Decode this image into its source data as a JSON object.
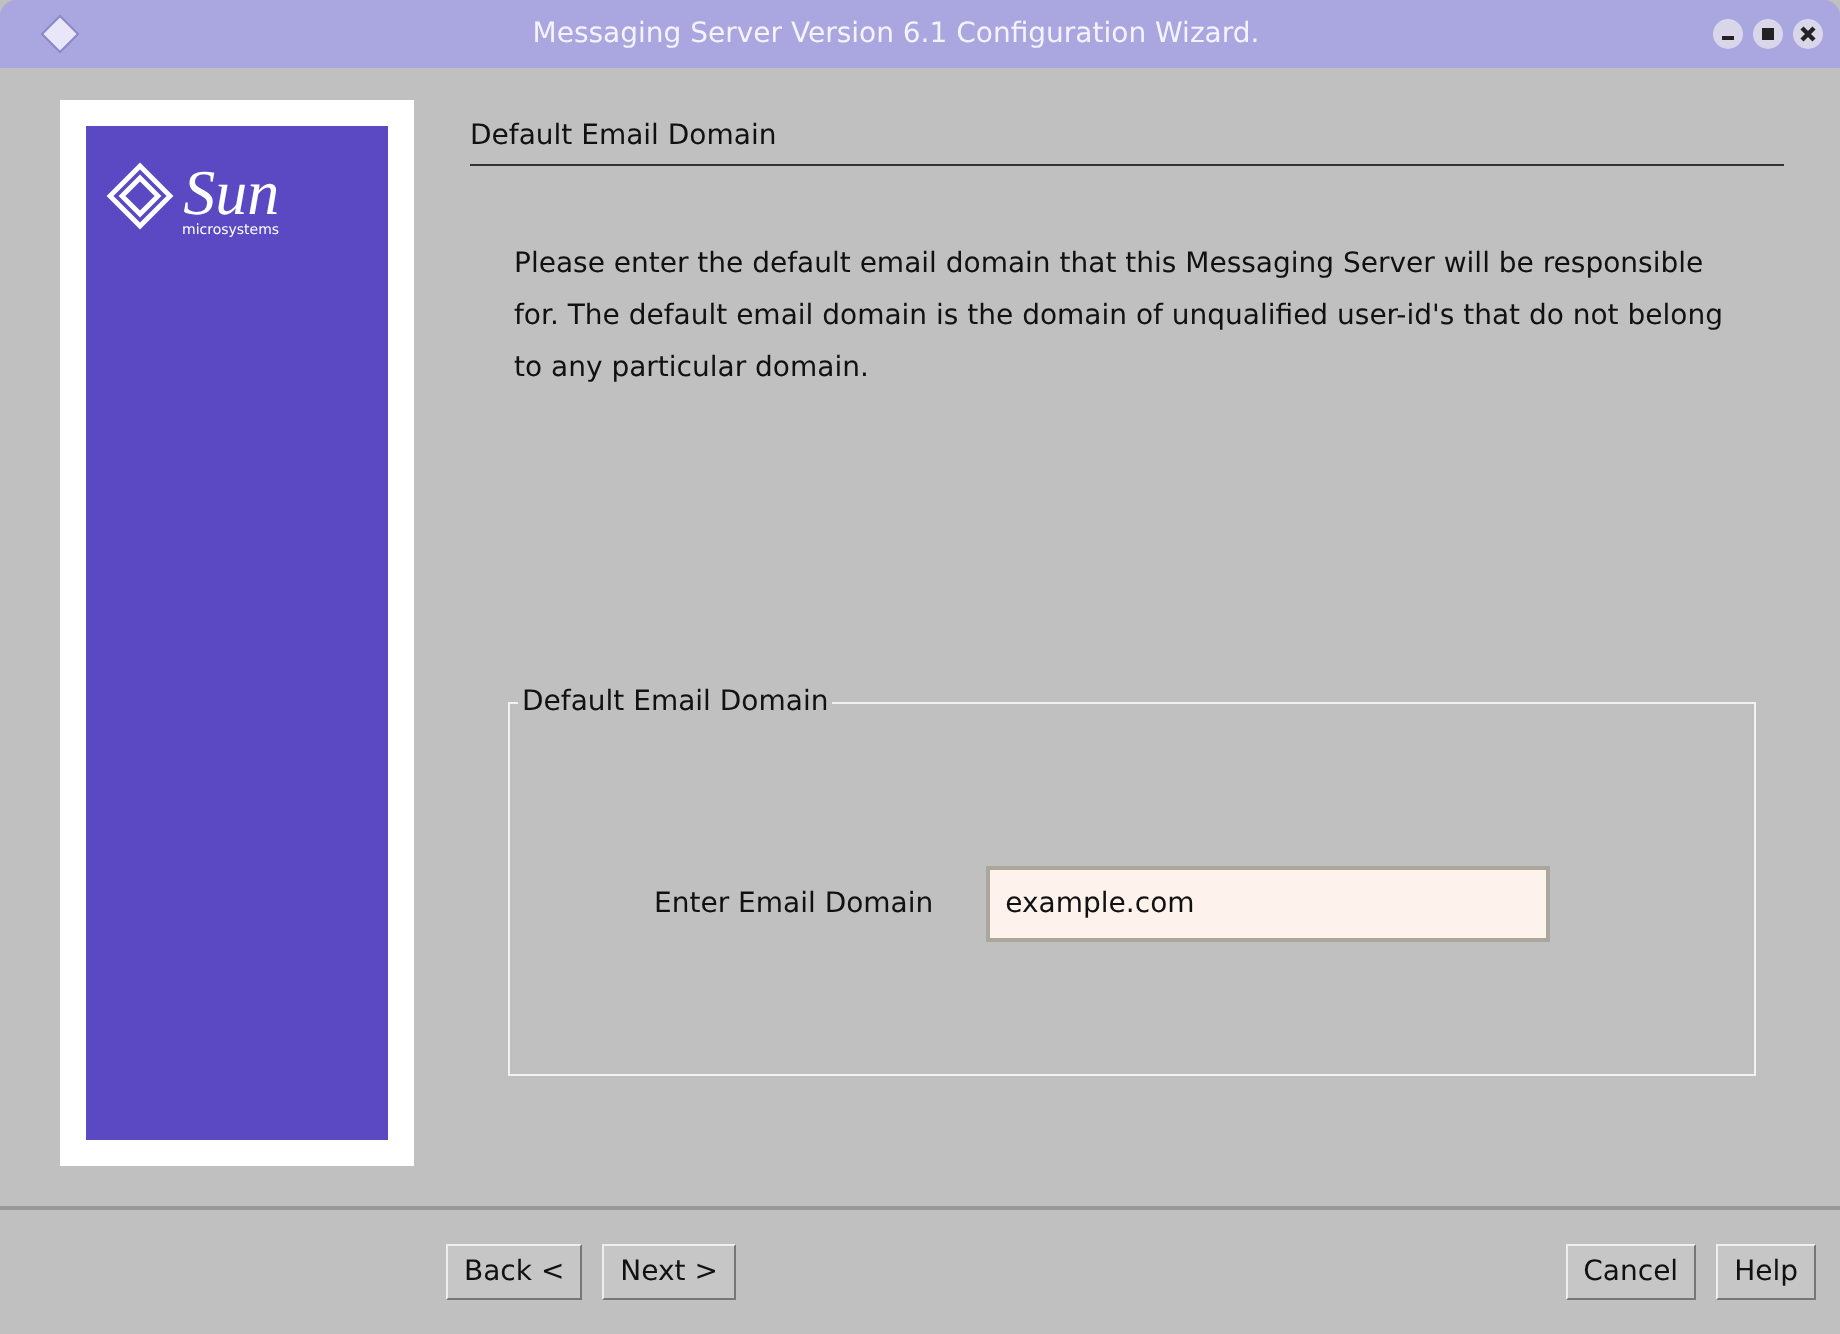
{
  "window": {
    "title": "Messaging Server Version 6.1 Configuration Wizard."
  },
  "logo": {
    "name": "Sun",
    "tagline": "microsystems"
  },
  "page": {
    "heading": "Default Email Domain",
    "description": "Please enter the default email domain that this Messaging Server will be responsible for. The default email domain is the domain of unqualified user-id's that do not belong to any particular domain."
  },
  "group": {
    "title": "Default Email Domain",
    "label": "Enter Email Domain",
    "value": "example.com"
  },
  "buttons_left": [
    "Back <",
    "Next >"
  ],
  "buttons_right": [
    "Cancel",
    "Help"
  ]
}
